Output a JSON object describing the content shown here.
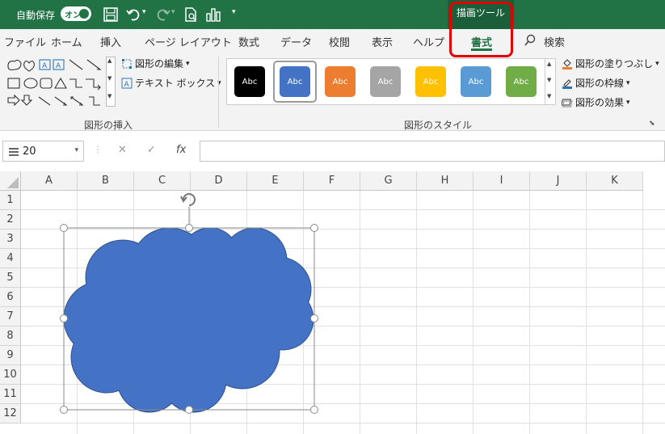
{
  "titlebar": {
    "autosave_label": "自動保存",
    "toggle_text": "オン",
    "context_tab": "描画ツール",
    "colors": {
      "bar": "#217346",
      "context": "#1b5e3a"
    }
  },
  "tabs": [
    {
      "label": "ファイル"
    },
    {
      "label": "ホーム"
    },
    {
      "label": "挿入"
    },
    {
      "label": "ページ レイアウト"
    },
    {
      "label": "数式"
    },
    {
      "label": "データ"
    },
    {
      "label": "校閲"
    },
    {
      "label": "表示"
    },
    {
      "label": "ヘルプ"
    },
    {
      "label": "書式"
    }
  ],
  "search": {
    "label": "検索"
  },
  "ribbon": {
    "edit_shape": "図形の編集",
    "text_box": "テキスト ボックス",
    "insert_shapes_group": "図形の挿入",
    "shape_styles_group": "図形のスタイル",
    "shape_fill": "図形の塗りつぶし",
    "shape_outline": "図形の枠線",
    "shape_effects": "図形の効果",
    "style_swatches": [
      {
        "text": "Abc",
        "color": "#000000"
      },
      {
        "text": "Abc",
        "color": "#4472c4"
      },
      {
        "text": "Abc",
        "color": "#ed7d31"
      },
      {
        "text": "Abc",
        "color": "#a5a5a5"
      },
      {
        "text": "Abc",
        "color": "#ffc000"
      },
      {
        "text": "Abc",
        "color": "#5b9bd5"
      },
      {
        "text": "Abc",
        "color": "#70ad47"
      }
    ]
  },
  "formula_bar": {
    "name_box": "20",
    "cancel": "✕",
    "enter": "✓",
    "fx": "fx",
    "value": ""
  },
  "sheet": {
    "columns": [
      "A",
      "B",
      "C",
      "D",
      "E",
      "F",
      "G",
      "H",
      "I",
      "J",
      "K"
    ],
    "rows": [
      "1",
      "2",
      "3",
      "4",
      "5",
      "6",
      "7",
      "8",
      "9",
      "10",
      "11",
      "12"
    ],
    "shape_color": "#4472c4"
  }
}
